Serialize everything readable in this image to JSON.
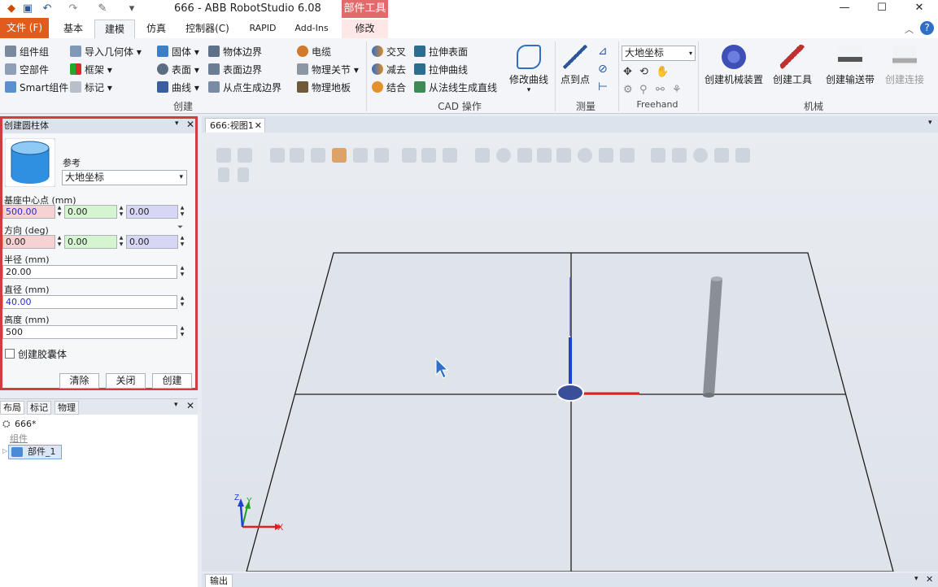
{
  "window": {
    "title": "666 - ABB RobotStudio 6.08",
    "context_tab_group": "部件工具",
    "minimize": "—",
    "maximize": "☐",
    "close": "✕"
  },
  "tabs": {
    "file": "文件 (F)",
    "items": [
      "基本",
      "建模",
      "仿真",
      "控制器(C)",
      "RAPID",
      "Add-Ins",
      "修改"
    ]
  },
  "ribbon": {
    "group_create": {
      "label": "创建",
      "items": [
        "组件组",
        "空部件",
        "Smart组件",
        "导入几何体",
        "框架",
        "标记",
        "固体",
        "表面",
        "曲线",
        "物体边界",
        "表面边界",
        "从点生成边界",
        "电缆",
        "物理关节",
        "物理地板"
      ]
    },
    "group_cad": {
      "label": "CAD 操作",
      "items": [
        "交叉",
        "减去",
        "结合",
        "拉伸表面",
        "拉伸曲线",
        "从法线生成直线",
        "修改曲线"
      ]
    },
    "group_measure": {
      "label": "测量",
      "items": [
        "点到点"
      ]
    },
    "group_freehand": {
      "label": "Freehand",
      "reference_value": "大地坐标"
    },
    "group_mech": {
      "label": "机械",
      "items": [
        "创建机械装置",
        "创建工具",
        "创建输送带",
        "创建连接"
      ]
    }
  },
  "create_cylinder_panel": {
    "title": "创建圆柱体",
    "reference_label": "参考",
    "reference_value": "大地坐标",
    "base_center_label": "基座中心点 (mm)",
    "base_center": [
      "500.00",
      "0.00",
      "0.00"
    ],
    "orientation_label": "方向 (deg)",
    "orientation": [
      "0.00",
      "0.00",
      "0.00"
    ],
    "radius_label": "半径 (mm)",
    "radius": "20.00",
    "diameter_label": "直径 (mm)",
    "diameter": "40.00",
    "height_label": "高度 (mm)",
    "height": "500",
    "capsule_label": "创建胶囊体",
    "capsule_checked": false,
    "btn_clear": "清除",
    "btn_close": "关闭",
    "btn_create": "创建"
  },
  "layout_panel": {
    "tabs": [
      "布局",
      "标记",
      "物理"
    ],
    "station": "666*",
    "group_label": "组件",
    "part": "部件_1"
  },
  "viewport": {
    "tab": "666:视图1",
    "axis_x": "X",
    "axis_y": "Y",
    "axis_z": "Z"
  },
  "output_tab": "输出",
  "colors": {
    "file_tab": "#e05b1c",
    "context_tab": "#e26a6a",
    "panel_highlight": "#d23c3c",
    "axis_x": "#e02020",
    "axis_y": "#20a020",
    "axis_z": "#1f3fd8"
  }
}
